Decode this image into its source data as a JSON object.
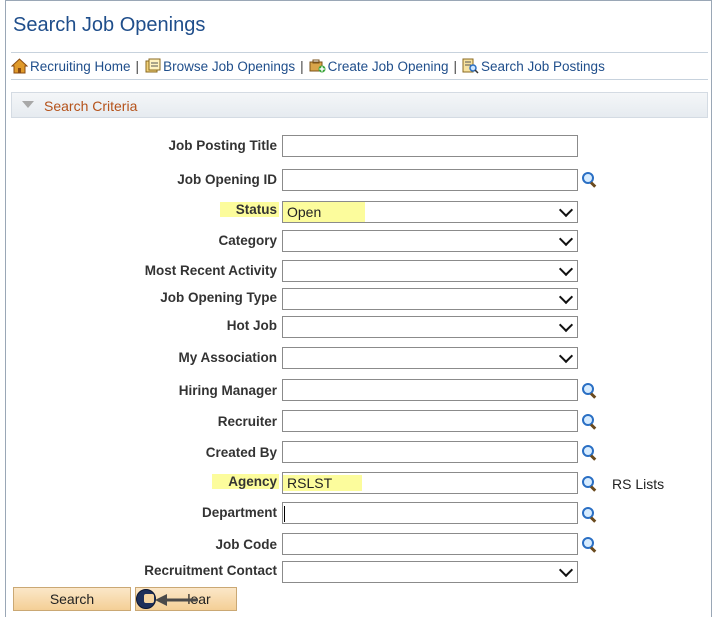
{
  "page": {
    "title": "Search Job Openings"
  },
  "links": [
    {
      "label": "Recruiting Home",
      "icon": "home-icon"
    },
    {
      "label": "Browse Job Openings",
      "icon": "browse-icon"
    },
    {
      "label": "Create Job Opening",
      "icon": "create-icon"
    },
    {
      "label": "Search Job Postings",
      "icon": "search-postings-icon"
    }
  ],
  "link_separator": "|",
  "criteria": {
    "title": "Search Criteria"
  },
  "fields": {
    "job_posting_title": {
      "label": "Job Posting Title",
      "value": ""
    },
    "job_opening_id": {
      "label": "Job Opening ID",
      "value": ""
    },
    "status": {
      "label": "Status",
      "value": "Open"
    },
    "category": {
      "label": "Category",
      "value": ""
    },
    "most_recent_activity": {
      "label": "Most Recent Activity",
      "value": ""
    },
    "job_opening_type": {
      "label": "Job Opening Type",
      "value": ""
    },
    "hot_job": {
      "label": "Hot Job",
      "value": ""
    },
    "my_association": {
      "label": "My Association",
      "value": ""
    },
    "hiring_manager": {
      "label": "Hiring Manager",
      "value": ""
    },
    "recruiter": {
      "label": "Recruiter",
      "value": ""
    },
    "created_by": {
      "label": "Created By",
      "value": ""
    },
    "agency": {
      "label": "Agency",
      "value": "RSLST",
      "extra": "RS Lists"
    },
    "department": {
      "label": "Department",
      "value": ""
    },
    "job_code": {
      "label": "Job Code",
      "value": ""
    },
    "recruitment_contact": {
      "label": "Recruitment Contact",
      "value": ""
    }
  },
  "buttons": {
    "search": "Search",
    "clear": "Clear",
    "clear_visible": "lear"
  },
  "colors": {
    "title": "#1f4e8b",
    "link": "#1f4e8b",
    "section_title": "#b5521a",
    "highlight": "#fcfc9c",
    "button_fill": "#f4cf96"
  }
}
